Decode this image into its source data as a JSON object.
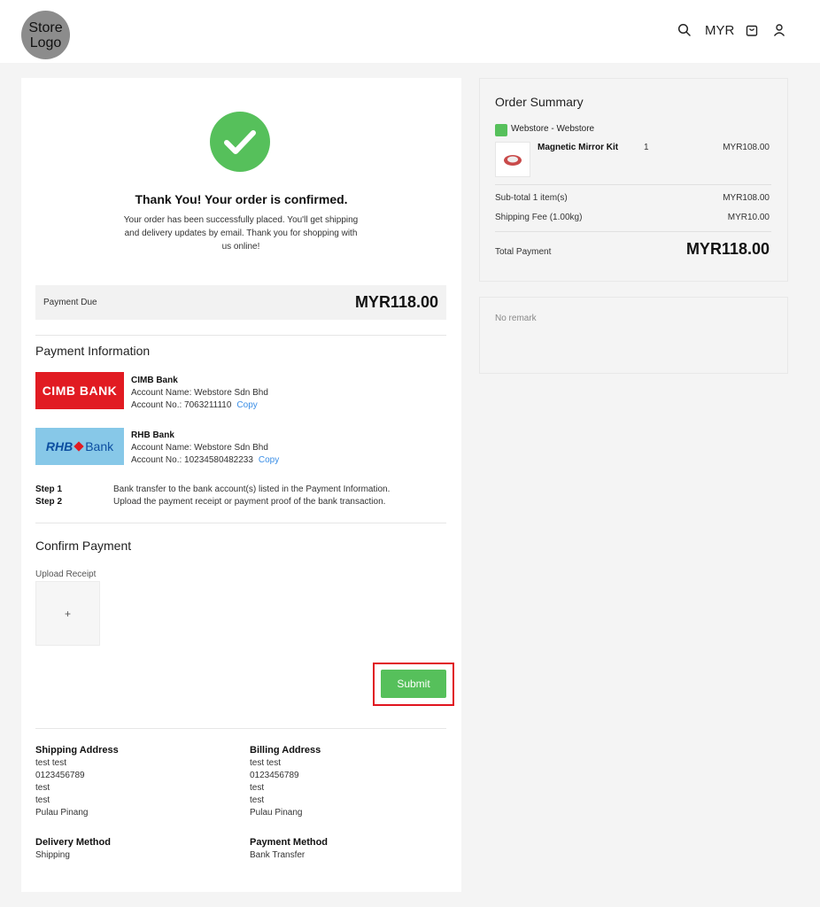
{
  "header": {
    "logo_text": "Store Logo",
    "currency": "MYR",
    "icons": [
      "search-icon",
      "cart-icon",
      "user-icon"
    ]
  },
  "confirmation": {
    "title": "Thank You! Your order is confirmed.",
    "message": "Your order has been successfully placed. You'll get shipping and delivery updates by email. Thank you for shopping with us online!",
    "icon": "check-icon",
    "accent_color": "#56c05b"
  },
  "payment_due": {
    "label": "Payment Due",
    "amount": "MYR118.00"
  },
  "payment_information": {
    "title": "Payment Information",
    "banks": [
      {
        "logo_text": "CIMB BANK",
        "name": "CIMB Bank",
        "account_name": "Account Name: Webstore Sdn Bhd",
        "account_no": "Account No.: 7063211110",
        "copy_label": "Copy",
        "color": "#e11b22"
      },
      {
        "logo_text_1": "RHB",
        "logo_text_2": "Bank",
        "name": "RHB Bank",
        "account_name": "Account Name: Webstore Sdn Bhd",
        "account_no": "Account No.: 10234580482233",
        "copy_label": "Copy",
        "color": "#87c8e8"
      }
    ],
    "steps": [
      {
        "label": "Step 1",
        "text": "Bank transfer to the bank account(s) listed in the Payment Information."
      },
      {
        "label": "Step 2",
        "text": "Upload the payment receipt or payment proof of the bank transaction."
      }
    ]
  },
  "confirm_payment": {
    "title": "Confirm Payment",
    "upload_label": "Upload Receipt",
    "upload_symbol": "+",
    "submit_label": "Submit"
  },
  "addresses": {
    "shipping": {
      "title": "Shipping Address",
      "lines": [
        "test test",
        "0123456789",
        "test",
        "test",
        "Pulau Pinang"
      ]
    },
    "billing": {
      "title": "Billing Address",
      "lines": [
        "test test",
        "0123456789",
        "test",
        "test",
        "Pulau Pinang"
      ]
    },
    "delivery": {
      "title": "Delivery Method",
      "value": "Shipping"
    },
    "payment": {
      "title": "Payment Method",
      "value": "Bank Transfer"
    }
  },
  "order_summary": {
    "title": "Order Summary",
    "store_name": "Webstore - Webstore",
    "product": {
      "name": "Magnetic Mirror Kit",
      "qty": "1",
      "price": "MYR108.00"
    },
    "subtotal_label": "Sub-total 1 item(s)",
    "subtotal_value": "MYR108.00",
    "shipping_label": "Shipping Fee (1.00kg)",
    "shipping_value": "MYR10.00",
    "total_label": "Total Payment",
    "total_value": "MYR118.00"
  },
  "remark": {
    "text": "No remark"
  }
}
